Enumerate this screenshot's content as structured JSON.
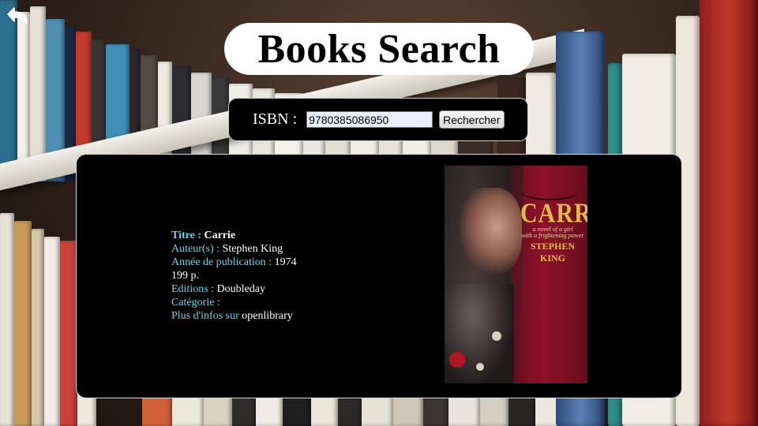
{
  "header": {
    "title": "Books Search",
    "back_icon": "back-arrow-icon"
  },
  "search": {
    "label": "ISBN :",
    "value": "9780385086950",
    "button_label": "Rechercher"
  },
  "result": {
    "title_label": "Titre :",
    "title_value": "Carrie",
    "author_label": "Auteur(s) :",
    "author_value": "Stephen King",
    "year_label": "Année de publication :",
    "year_value": "1974",
    "pages": "199 p.",
    "publisher_label": "Editions :",
    "publisher_value": "Doubleday",
    "category_label": "Catégorie :",
    "category_value": "",
    "more_label": "Plus d'infos sur",
    "more_value": "openlibrary"
  },
  "cover": {
    "title": "CARRIE",
    "subtitle_line1": "a novel of a girl",
    "subtitle_line2": "with a frightening power",
    "author": "STEPHEN KING"
  },
  "colors": {
    "card_bg": "#000000",
    "label_color": "#6fd3e6",
    "title_pill_bg": "#ffffff"
  }
}
